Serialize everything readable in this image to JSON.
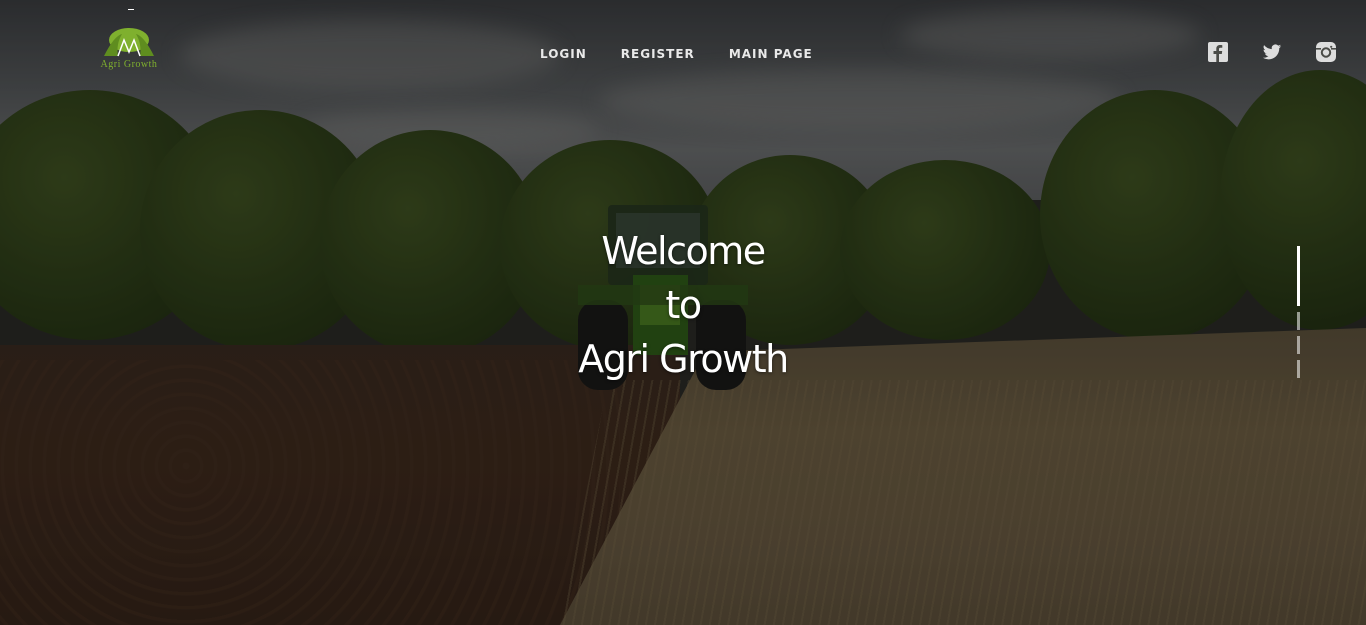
{
  "brand": {
    "name": "Agri Growth",
    "logo_text": "Agri Growth",
    "accent_color": "#7fb02e"
  },
  "nav": {
    "items": [
      {
        "label": "LOGIN"
      },
      {
        "label": "REGISTER"
      },
      {
        "label": "MAIN PAGE"
      }
    ]
  },
  "social": {
    "icons": [
      "facebook-icon",
      "twitter-icon",
      "instagram-icon"
    ]
  },
  "hero": {
    "line1": "Welcome",
    "line2": "to",
    "line3": "Agri Growth"
  },
  "slider": {
    "count": 4,
    "active_index": 0
  }
}
